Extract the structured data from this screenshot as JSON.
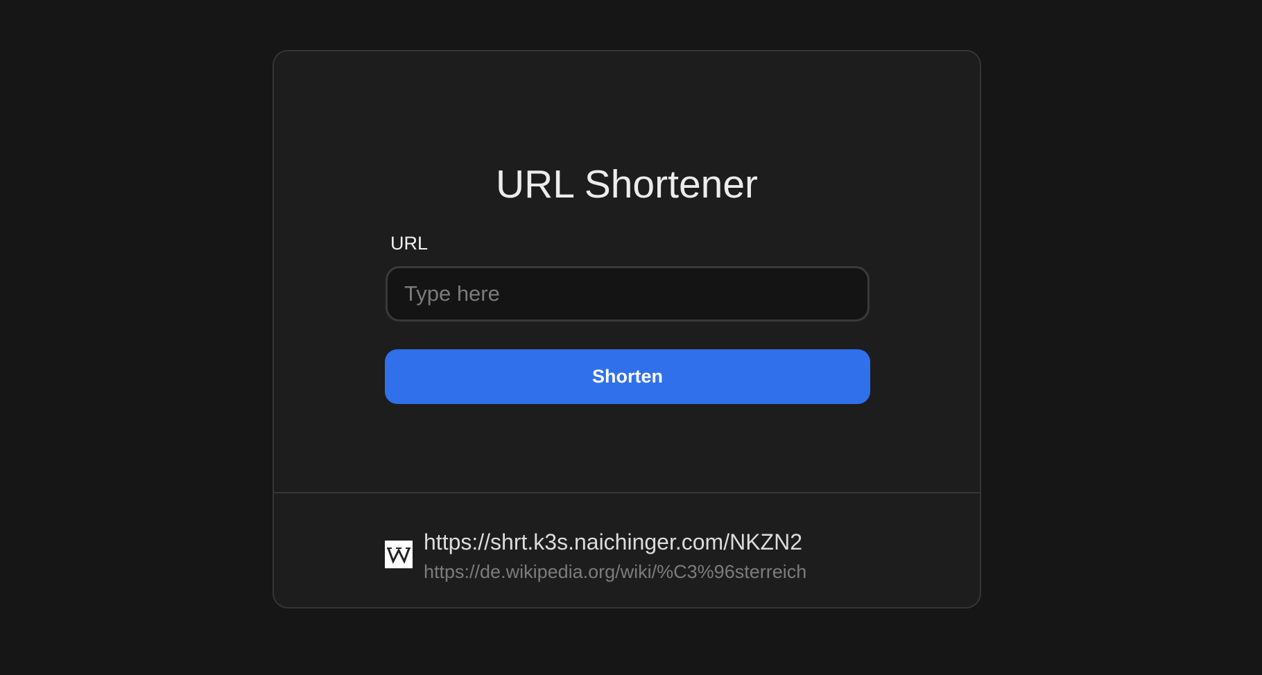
{
  "app": {
    "title": "URL Shortener"
  },
  "form": {
    "url_label": "URL",
    "url_input_value": "",
    "url_input_placeholder": "Type here",
    "submit_label": "Shorten"
  },
  "results": [
    {
      "favicon": "wikipedia-w-icon",
      "short_url": "https://shrt.k3s.naichinger.com/NKZN2",
      "original_url": "https://de.wikipedia.org/wiki/%C3%96sterreich"
    }
  ],
  "colors": {
    "page_background": "#161616",
    "card_background": "#1d1d1d",
    "accent": "#3070eb"
  }
}
